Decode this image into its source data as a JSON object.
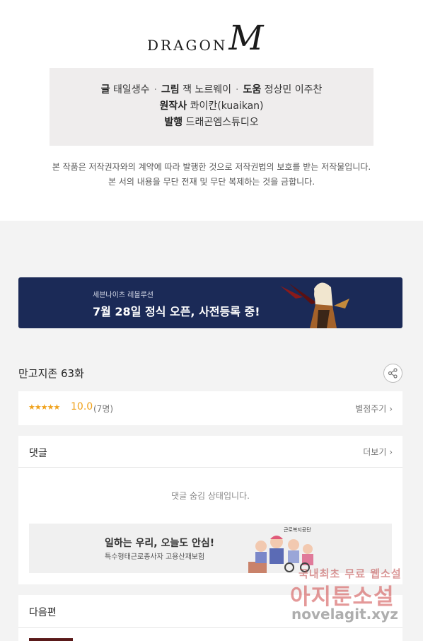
{
  "logo": {
    "word": "DRAGON",
    "mark": "M"
  },
  "credits": {
    "line1": [
      {
        "label": "글",
        "value": "태일생수"
      },
      {
        "label": "그림",
        "value": "잭 노르웨이"
      },
      {
        "label": "도움",
        "value": "정상민 이주찬"
      }
    ],
    "separator": "·",
    "original_label": "원작사",
    "original_value": "콰이칸(kuaikan)",
    "publisher_label": "발행",
    "publisher_value": "드래곤엠스튜디오"
  },
  "notice": {
    "line1": "본 작품은 저작권자와의 계약에 따라 발행한 것으로 저작권법의 보호를 받는 저작물입니다.",
    "line2": "본 서의 내용을 무단 전재 및 무단 복제하는 것을 금합니다."
  },
  "banner": {
    "subtitle": "세븐나이츠 레볼루션",
    "title": "7월 28일 정식 오픈, 사전등록 중!",
    "bg_color": "#1b2a57"
  },
  "episode": {
    "title": "만고지존 63화",
    "share_icon": "share-icon"
  },
  "rating": {
    "stars": "★★★★★",
    "score": "10.0",
    "count": "(7명)",
    "rate_link": "별점주기",
    "star_color": "#f0a21c"
  },
  "comments": {
    "title": "댓글",
    "more": "더보기",
    "hidden_message": "댓글 숨김 상태입니다."
  },
  "ad": {
    "title": "일하는 우리, 오늘도 안심!",
    "subtitle": "특수형태근로종사자 고용산재보험",
    "org": "근로복지공단"
  },
  "next": {
    "title": "다음편"
  },
  "watermark": {
    "line1": "국내최초 무료 웹소설",
    "line2": "아지툰소설",
    "line3": "novelagit.xyz"
  }
}
